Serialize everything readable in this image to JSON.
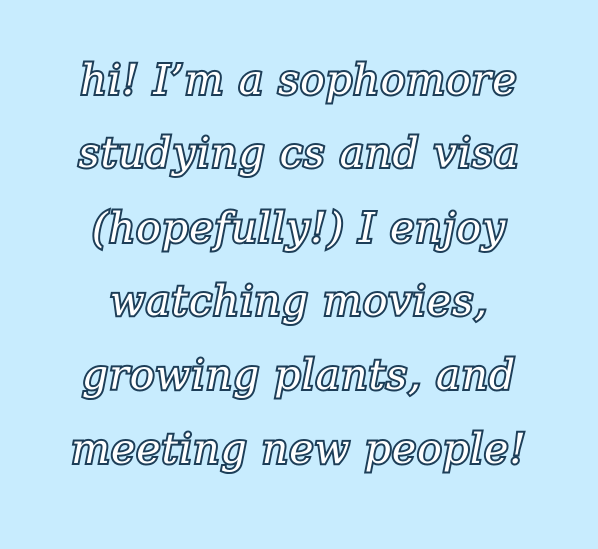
{
  "bio": {
    "lines": [
      "hi! I’m a sophomore",
      "studying cs and visa",
      "(hopefully!) I enjoy",
      "watching movies,",
      "growing plants, and",
      "meeting new people!"
    ]
  },
  "colors": {
    "background": "#c8ecfe",
    "text_fill": "#ffffff",
    "text_outline": "#1d3e58"
  }
}
